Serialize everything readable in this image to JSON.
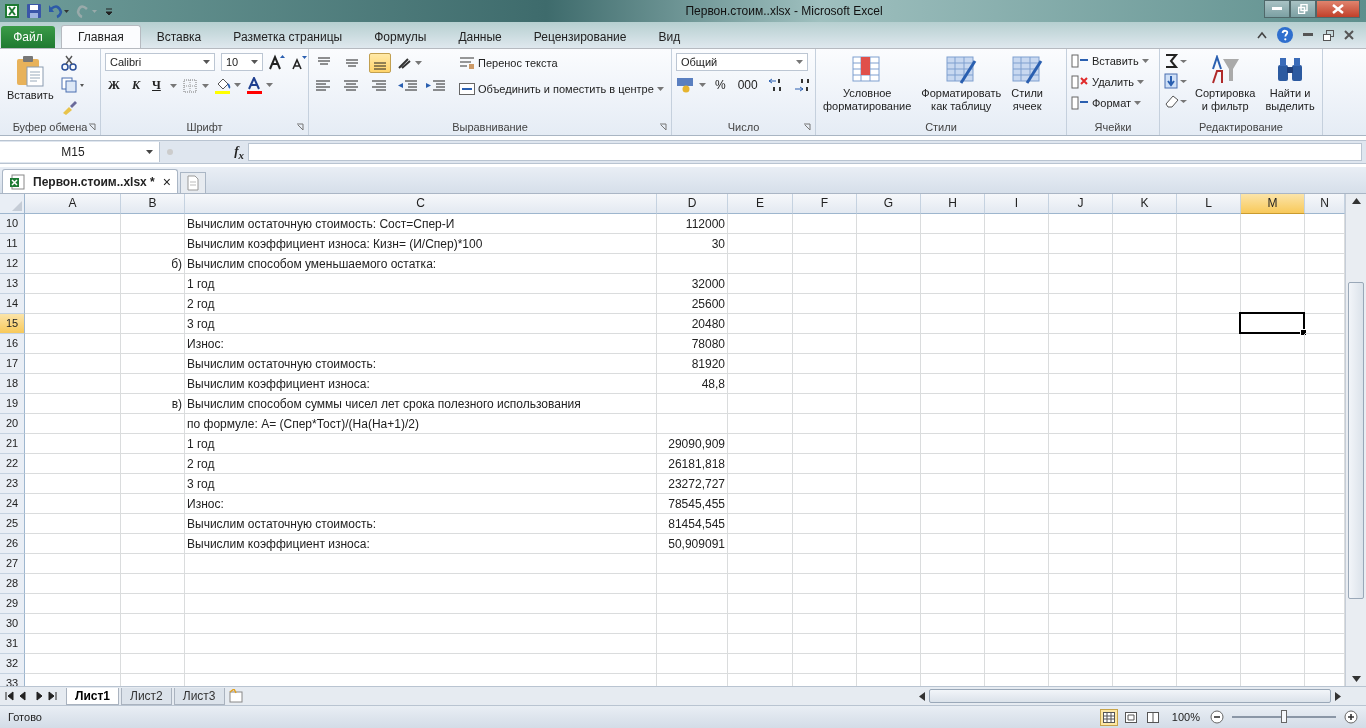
{
  "window": {
    "title": "Первон.стоим..xlsx  -  Microsoft Excel"
  },
  "ribbon_tabs": [
    {
      "label": "Файл",
      "kind": "file",
      "selected": false
    },
    {
      "label": "Главная",
      "kind": "tab",
      "selected": true
    },
    {
      "label": "Вставка",
      "kind": "tab",
      "selected": false
    },
    {
      "label": "Разметка страницы",
      "kind": "tab",
      "selected": false
    },
    {
      "label": "Формулы",
      "kind": "tab",
      "selected": false
    },
    {
      "label": "Данные",
      "kind": "tab",
      "selected": false
    },
    {
      "label": "Рецензирование",
      "kind": "tab",
      "selected": false
    },
    {
      "label": "Вид",
      "kind": "tab",
      "selected": false
    }
  ],
  "ribbon": {
    "clipboard": {
      "label": "Буфер обмена",
      "paste": "Вставить"
    },
    "font": {
      "label": "Шрифт",
      "family": "Calibri",
      "size": "10",
      "bold": "Ж",
      "italic": "К",
      "underline": "Ч"
    },
    "alignment": {
      "label": "Выравнивание",
      "wrap": "Перенос текста",
      "merge": "Объединить и поместить в центре",
      "vertical": [
        {
          "selected": false
        },
        {
          "selected": false
        },
        {
          "selected": true
        }
      ]
    },
    "number": {
      "label": "Число",
      "format": "Общий",
      "percent": "%",
      "thousands": "000"
    },
    "styles": {
      "label": "Стили",
      "buttons": [
        {
          "lines": [
            "Условное",
            "форматирование"
          ]
        },
        {
          "lines": [
            "Форматировать",
            "как таблицу"
          ]
        },
        {
          "lines": [
            "Стили",
            "ячеек"
          ]
        }
      ]
    },
    "cells": {
      "label": "Ячейки",
      "buttons": [
        "Вставить",
        "Удалить",
        "Формат"
      ]
    },
    "editing": {
      "label": "Редактирование",
      "buttons": [
        {
          "lines": [
            "Сортировка",
            "и фильтр"
          ]
        },
        {
          "lines": [
            "Найти и",
            "выделить"
          ]
        }
      ]
    }
  },
  "name_box": "M15",
  "function_label": "f$_{x}$",
  "document_tab": {
    "title": "Первон.стоим..xlsx *",
    "close": "×"
  },
  "sheet": {
    "columns": [
      {
        "label": "A",
        "selected": false
      },
      {
        "label": "B",
        "selected": false
      },
      {
        "label": "C",
        "selected": false
      },
      {
        "label": "D",
        "selected": false
      },
      {
        "label": "E",
        "selected": false
      },
      {
        "label": "F",
        "selected": false
      },
      {
        "label": "G",
        "selected": false
      },
      {
        "label": "H",
        "selected": false
      },
      {
        "label": "I",
        "selected": false
      },
      {
        "label": "J",
        "selected": false
      },
      {
        "label": "K",
        "selected": false
      },
      {
        "label": "L",
        "selected": false
      },
      {
        "label": "M",
        "selected": true
      },
      {
        "label": "N",
        "selected": false
      }
    ],
    "rows": [
      {
        "number": "10",
        "selected": false,
        "c": "Вычислим остаточную стоимость: Сост=Спер-И",
        "d": "112000"
      },
      {
        "number": "11",
        "selected": false,
        "c": "Вычислим коэффициент износа: Кизн= (И/Спер)*100",
        "d": "30"
      },
      {
        "number": "12",
        "selected": false,
        "b": "б)",
        "c": "Вычислим способом уменьшаемого остатка:"
      },
      {
        "number": "13",
        "selected": false,
        "c": "1 год",
        "d": "32000"
      },
      {
        "number": "14",
        "selected": false,
        "c": "2 год",
        "d": "25600"
      },
      {
        "number": "15",
        "selected": true,
        "c": "3 год",
        "d": "20480"
      },
      {
        "number": "16",
        "selected": false,
        "c": "Износ:",
        "d": "78080"
      },
      {
        "number": "17",
        "selected": false,
        "c": "Вычислим остаточную стоимость:",
        "d": "81920"
      },
      {
        "number": "18",
        "selected": false,
        "c": "Вычислим коэффициент износа:",
        "d": "48,8"
      },
      {
        "number": "19",
        "selected": false,
        "b": "в)",
        "c": "Вычислим способом суммы чисел лет срока полезного использования"
      },
      {
        "number": "20",
        "selected": false,
        "c": "по формуле: А= (Спер*Тост)/(На(На+1)/2)"
      },
      {
        "number": "21",
        "selected": false,
        "c": "1 год",
        "d": "29090,909"
      },
      {
        "number": "22",
        "selected": false,
        "c": "2 год",
        "d": "26181,818"
      },
      {
        "number": "23",
        "selected": false,
        "c": "3 год",
        "d": "23272,727"
      },
      {
        "number": "24",
        "selected": false,
        "c": "Износ:",
        "d": "78545,455"
      },
      {
        "number": "25",
        "selected": false,
        "c": "Вычислим остаточную стоимость:",
        "d": "81454,545"
      },
      {
        "number": "26",
        "selected": false,
        "c": "Вычислим коэффициент износа:",
        "d": "50,909091"
      },
      {
        "number": "27",
        "selected": false
      },
      {
        "number": "28",
        "selected": false
      },
      {
        "number": "29",
        "selected": false
      },
      {
        "number": "30",
        "selected": false
      },
      {
        "number": "31",
        "selected": false
      },
      {
        "number": "32",
        "selected": false
      },
      {
        "number": "33",
        "selected": false
      }
    ]
  },
  "sheet_tabs": [
    {
      "label": "Лист1",
      "selected": true
    },
    {
      "label": "Лист2",
      "selected": false
    },
    {
      "label": "Лист3",
      "selected": false
    }
  ],
  "status_bar": {
    "status": "Готово",
    "views": [
      {
        "selected": true
      },
      {
        "selected": false
      },
      {
        "selected": false
      }
    ],
    "zoom": "100%",
    "zoom_slider": {
      "level": 0.5
    }
  }
}
